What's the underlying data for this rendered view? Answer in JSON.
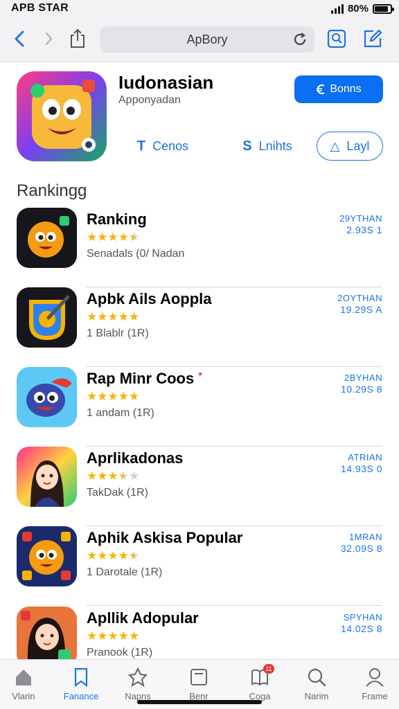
{
  "status_bar": {
    "carrier": "APB STAR",
    "battery_text": "80%",
    "battery_level": 0.85
  },
  "browser": {
    "url": "ApBory"
  },
  "app": {
    "title": "Iudonasian",
    "subtitle": "Apponyadan",
    "get_label": "Bonns",
    "actions": [
      {
        "glyph": "T",
        "label": "Cenos"
      },
      {
        "glyph": "S",
        "label": "Lnihts"
      },
      {
        "glyph": "△",
        "label": "Layl"
      }
    ]
  },
  "ranking": {
    "title": "Rankingg",
    "items": [
      {
        "name": "Ranking",
        "rating": 4.5,
        "meta": "Senadals (0/ Nadan",
        "stat1": "29YTHAN",
        "stat2": "2.93S 1"
      },
      {
        "name": "Apbk Ails Aoppla",
        "rating": 5,
        "meta": "1 Blablr (1R)",
        "stat1": "2OYTHAN",
        "stat2": "19.29S A"
      },
      {
        "name": "Rap Minr Coos",
        "rating": 5,
        "meta": "1 andam (1R)",
        "stat1": "2BYHAN",
        "stat2": "10.29S 8"
      },
      {
        "name": "Aprlikadonas",
        "rating": 3.5,
        "meta": "TakDak (1R)",
        "stat1": "ATRIAN",
        "stat2": "14.93S 0"
      },
      {
        "name": "Aphik Askisa Popular",
        "rating": 4.5,
        "meta": "1 Darotale (1R)",
        "stat1": "1MRAN",
        "stat2": "32.09S 8"
      },
      {
        "name": "Apllik Adopular",
        "rating": 5,
        "meta": "Pranook (1R)",
        "stat1": "SPYHAN",
        "stat2": "14.02S 8"
      }
    ]
  },
  "tabbar": {
    "tabs": [
      {
        "label": "Vlarin",
        "icon": "home-icon"
      },
      {
        "label": "Fanance",
        "icon": "bookmark-icon",
        "active": true
      },
      {
        "label": "Napns",
        "icon": "apps-icon"
      },
      {
        "label": "Benr",
        "icon": "news-icon"
      },
      {
        "label": "Coga",
        "icon": "book-icon",
        "badge": "11"
      },
      {
        "label": "Narim",
        "icon": "search-icon"
      },
      {
        "label": "Frame",
        "icon": "profile-icon"
      }
    ]
  }
}
